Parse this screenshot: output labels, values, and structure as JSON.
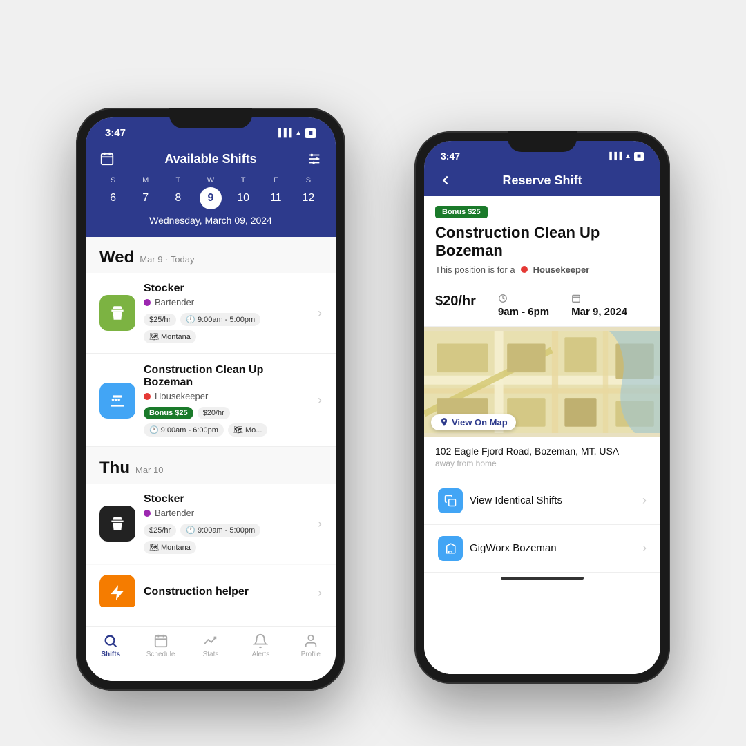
{
  "phone_left": {
    "status_time": "3:47",
    "header_title": "Available Shifts",
    "calendar": {
      "days": [
        "S",
        "M",
        "T",
        "W",
        "T",
        "F",
        "S"
      ],
      "dates": [
        "6",
        "7",
        "8",
        "9",
        "10",
        "11",
        "12"
      ],
      "selected_index": 3,
      "current_date": "Wednesday, March 09, 2024"
    },
    "sections": [
      {
        "day_short": "Wed",
        "day_info": "Mar 9 · Today",
        "shifts": [
          {
            "title": "Stocker",
            "role": "Bartender",
            "role_color": "purple",
            "icon_color": "green",
            "icon": "✂",
            "rate": "$25/hr",
            "time": "9:00am - 5:00pm",
            "location": "Montana",
            "bonus": null
          },
          {
            "title": "Construction Clean Up Bozeman",
            "role": "Housekeeper",
            "role_color": "red",
            "icon_color": "blue",
            "icon": "🧹",
            "rate": "$20/hr",
            "time": "9:00am - 6:00pm",
            "location": "Mo...",
            "bonus": "Bonus $25"
          }
        ]
      },
      {
        "day_short": "Thu",
        "day_info": "Mar 10",
        "shifts": [
          {
            "title": "Stocker",
            "role": "Bartender",
            "role_color": "purple",
            "icon_color": "black",
            "icon": "✂",
            "rate": "$25/hr",
            "time": "9:00am - 5:00pm",
            "location": "Montana",
            "bonus": null
          },
          {
            "title": "Construction helper",
            "role": "",
            "role_color": "",
            "icon_color": "orange",
            "icon": "🏗",
            "rate": "",
            "time": "",
            "location": "",
            "bonus": null
          }
        ]
      }
    ],
    "bottom_nav": [
      {
        "label": "Shifts",
        "icon": "🔍",
        "active": true
      },
      {
        "label": "Schedule",
        "icon": "📅",
        "active": false
      },
      {
        "label": "Stats",
        "icon": "📈",
        "active": false
      },
      {
        "label": "Alerts",
        "icon": "🔔",
        "active": false
      },
      {
        "label": "Profile",
        "icon": "👤",
        "active": false
      }
    ]
  },
  "phone_right": {
    "status_time": "3:47",
    "header_title": "Reserve Shift",
    "bonus_badge": "Bonus $25",
    "job_title": "Construction Clean Up Bozeman",
    "position_label": "This position is for a",
    "position_role": "Housekeeper",
    "rate": "$20/hr",
    "time": "9am - 6pm",
    "date": "Mar 9, 2024",
    "address": "102 Eagle Fjord Road, Bozeman, MT, USA",
    "address_sub": "away from home",
    "view_on_map": "View On Map",
    "actions": [
      {
        "label": "View Identical Shifts"
      },
      {
        "label": "GigWorx Bozeman"
      }
    ]
  }
}
